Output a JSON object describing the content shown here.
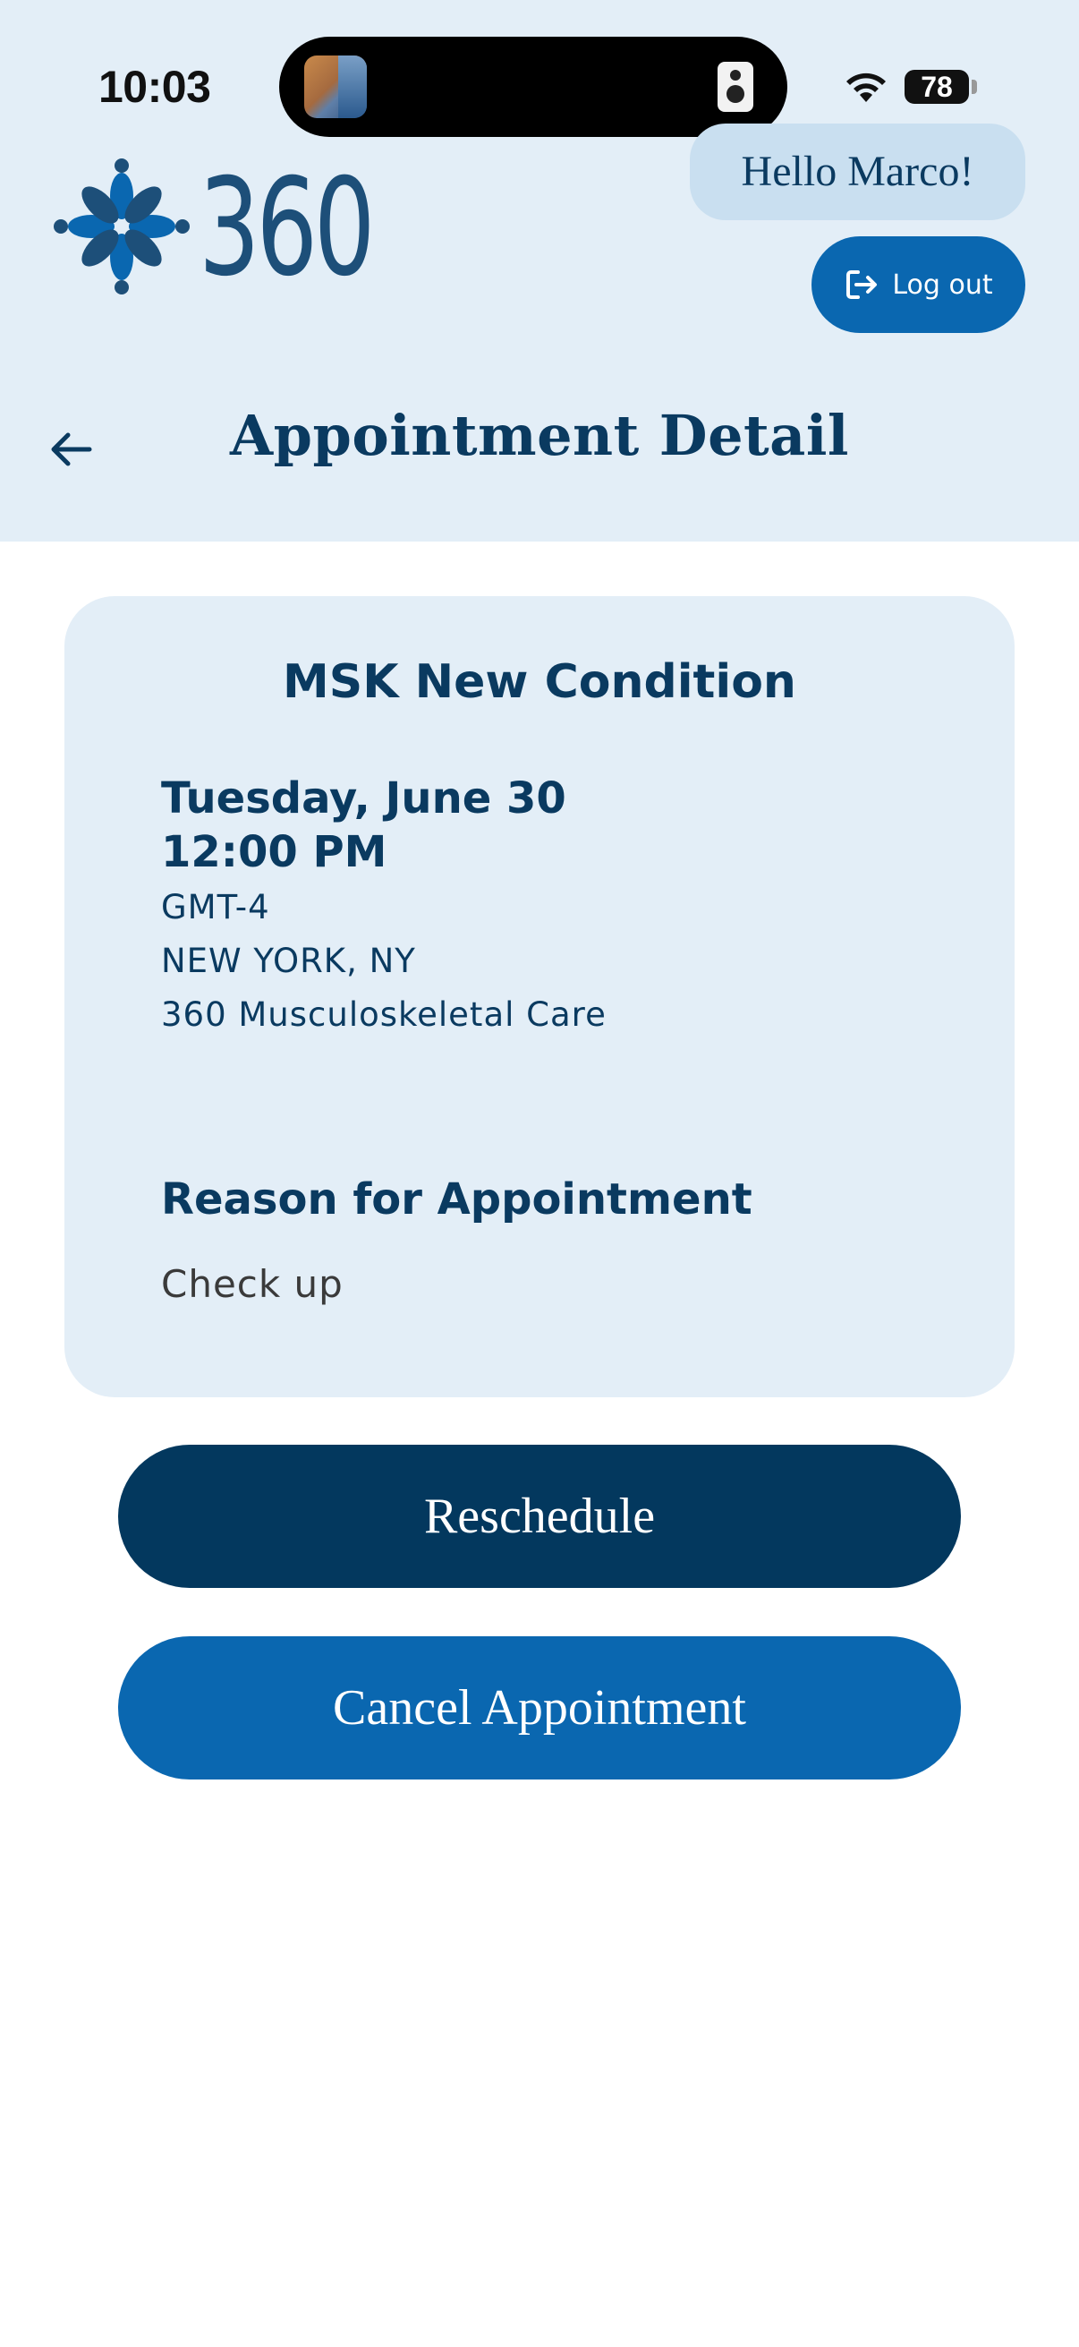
{
  "status_bar": {
    "time": "10:03",
    "battery": "78"
  },
  "header": {
    "logo_text": "360",
    "greeting": "Hello Marco!",
    "logout_label": "Log out",
    "page_title": "Appointment Detail"
  },
  "appointment": {
    "type": "MSK New Condition",
    "date": "Tuesday, June 30",
    "time": "12:00 PM",
    "timezone": "GMT-4",
    "city": "NEW YORK, NY",
    "clinic": "360 Musculoskeletal Care",
    "reason_heading": "Reason for Appointment",
    "reason": "Check up"
  },
  "actions": {
    "reschedule_label": "Reschedule",
    "cancel_label": "Cancel Appointment"
  },
  "colors": {
    "header_bg": "#e3eef7",
    "primary_dark": "#03385e",
    "primary": "#0a67b0",
    "text_dark": "#0a3a60"
  }
}
